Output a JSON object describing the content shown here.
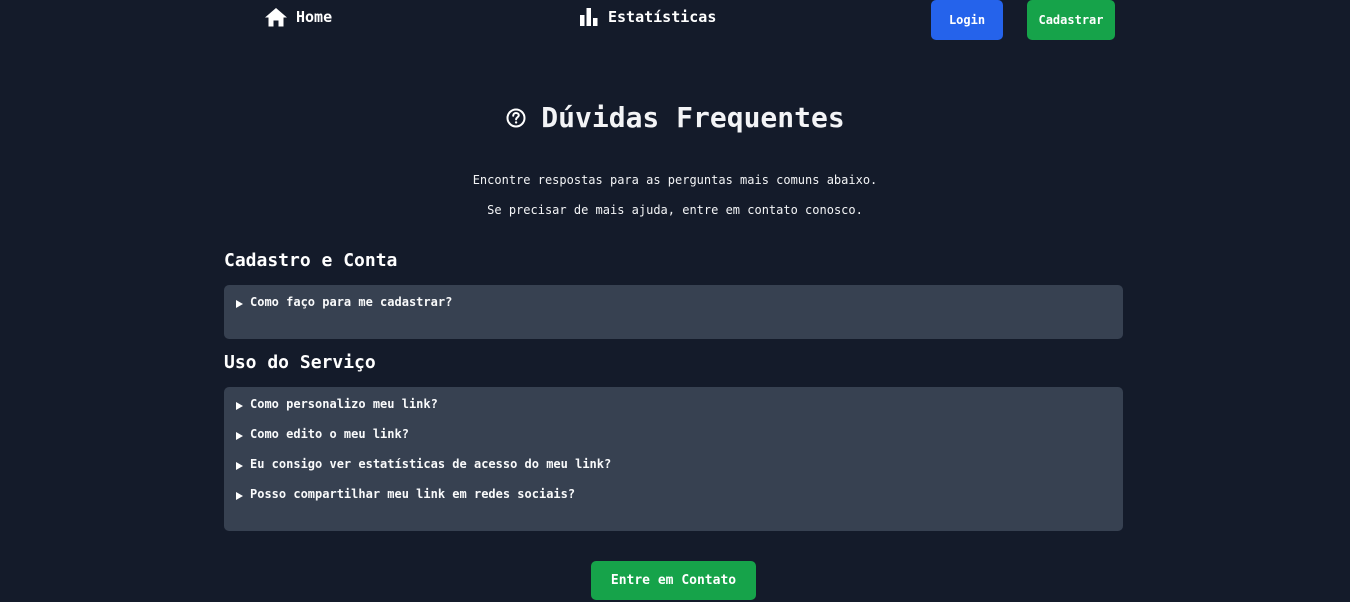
{
  "nav": {
    "home_label": "Home",
    "stats_label": "Estatísticas",
    "home_icon": "home-icon",
    "stats_icon": "bar-chart-icon",
    "login_label": "Login",
    "signup_label": "Cadastrar"
  },
  "header": {
    "title": "Dúvidas Frequentes",
    "title_icon": "question-circle-icon",
    "intro_line1": "Encontre respostas para as perguntas mais comuns abaixo.",
    "intro_line2": "Se precisar de mais ajuda, entre em contato conosco."
  },
  "sections": [
    {
      "title": "Cadastro e Conta",
      "questions": [
        "Como faço para me cadastrar?"
      ]
    },
    {
      "title": "Uso do Serviço",
      "questions": [
        "Como personalizo meu link?",
        "Como edito o meu link?",
        "Eu consigo ver estatísticas de acesso do meu link?",
        "Posso compartilhar meu link em redes sociais?"
      ]
    }
  ],
  "contact_button_label": "Entre em Contato",
  "colors": {
    "background": "#141b2a",
    "panel": "#374151",
    "primary": "#2563eb",
    "success": "#16a34a",
    "text": "#f3f4f6"
  }
}
